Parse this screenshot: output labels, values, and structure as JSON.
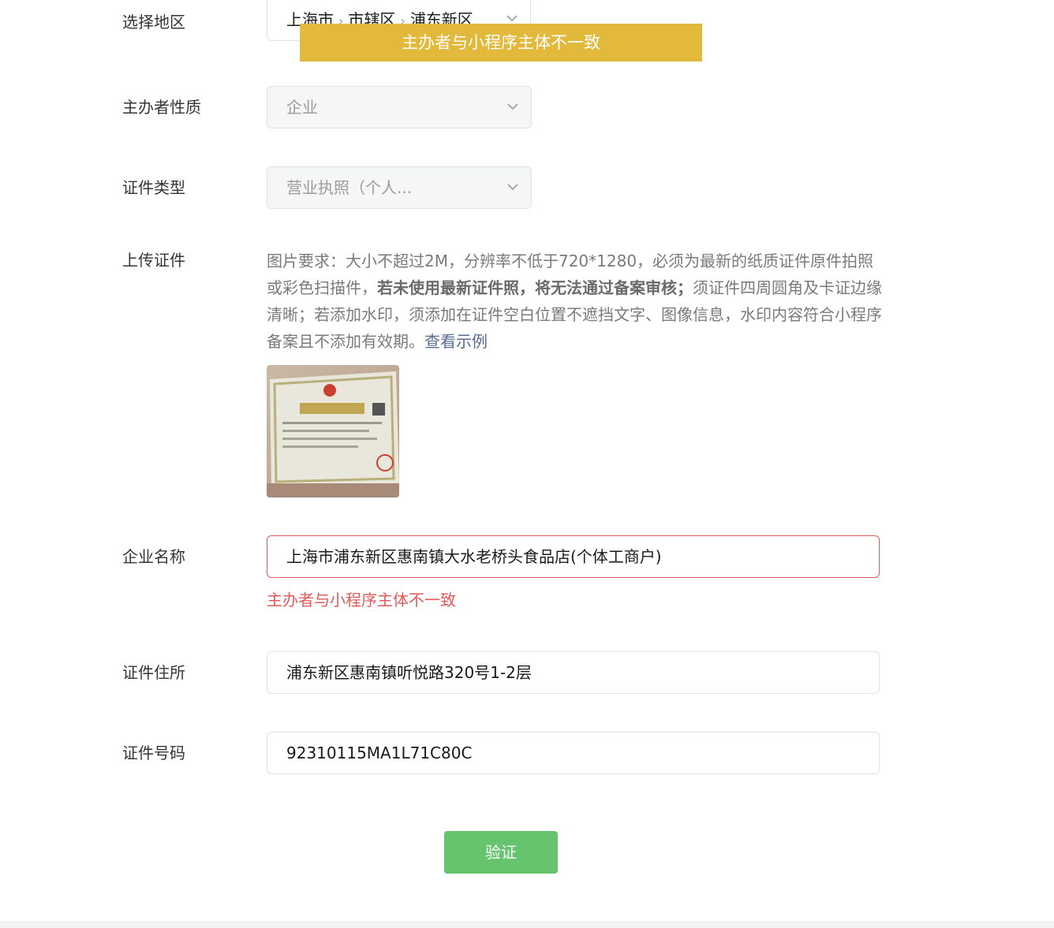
{
  "form": {
    "region": {
      "label": "选择地区",
      "province": "上海市",
      "city": "市辖区",
      "district": "浦东新区"
    },
    "organizer_type": {
      "label": "主办者性质",
      "value": "企业"
    },
    "cert_type": {
      "label": "证件类型",
      "value": "营业执照（个人..."
    },
    "upload": {
      "label": "上传证件",
      "hint_part1": "图片要求：大小不超过2M，分辨率不低于720*1280，必须为最新的纸质证件原件拍照或彩色扫描件，",
      "hint_bold": "若未使用最新证件照，将无法通过备案审核；",
      "hint_part2": "须证件四周圆角及卡证边缘清晰；若添加水印，须添加在证件空白位置不遮挡文字、图像信息，水印内容符合小程序备案且不添加有效期。",
      "example_link": "查看示例"
    },
    "company_name": {
      "label": "企业名称",
      "value": "上海市浦东新区惠南镇大水老桥头食品店(个体工商户)",
      "error": "主办者与小程序主体不一致"
    },
    "cert_address": {
      "label": "证件住所",
      "value": "浦东新区惠南镇听悦路320号1-2层"
    },
    "cert_number": {
      "label": "证件号码",
      "value": "92310115MA1L71C80C"
    },
    "submit_label": "验证"
  },
  "toast": {
    "message": "主办者与小程序主体不一致"
  },
  "colors": {
    "toast_bg": "#e2b93b",
    "error": "#e25a5a",
    "primary_button": "#66c46f",
    "link": "#576b95"
  }
}
